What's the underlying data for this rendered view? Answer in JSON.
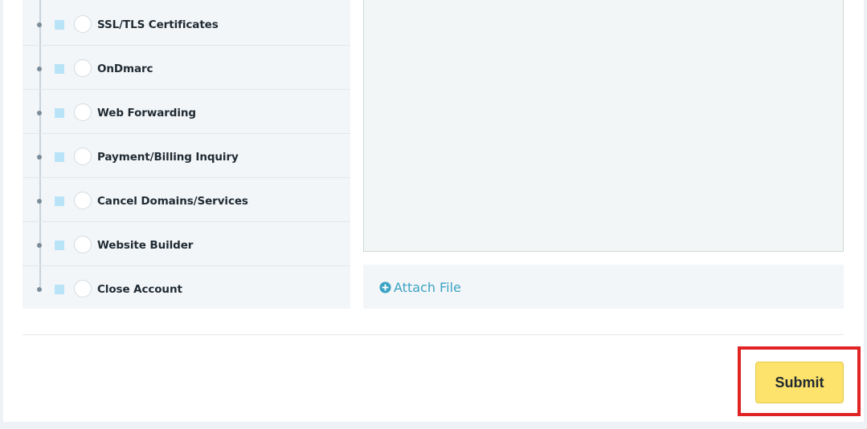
{
  "topics": [
    {
      "label": "SSL/TLS Certificates"
    },
    {
      "label": "OnDmarc"
    },
    {
      "label": "Web Forwarding"
    },
    {
      "label": "Payment/Billing Inquiry"
    },
    {
      "label": "Cancel Domains/Services"
    },
    {
      "label": "Website Builder"
    },
    {
      "label": "Close Account"
    }
  ],
  "attach": {
    "label": "Attach File",
    "icon": "plus-circle-icon"
  },
  "submit": {
    "label": "Submit"
  },
  "colors": {
    "accent_link": "#3ba3c4",
    "submit_bg": "#fde36b",
    "highlight": "#e02424"
  }
}
